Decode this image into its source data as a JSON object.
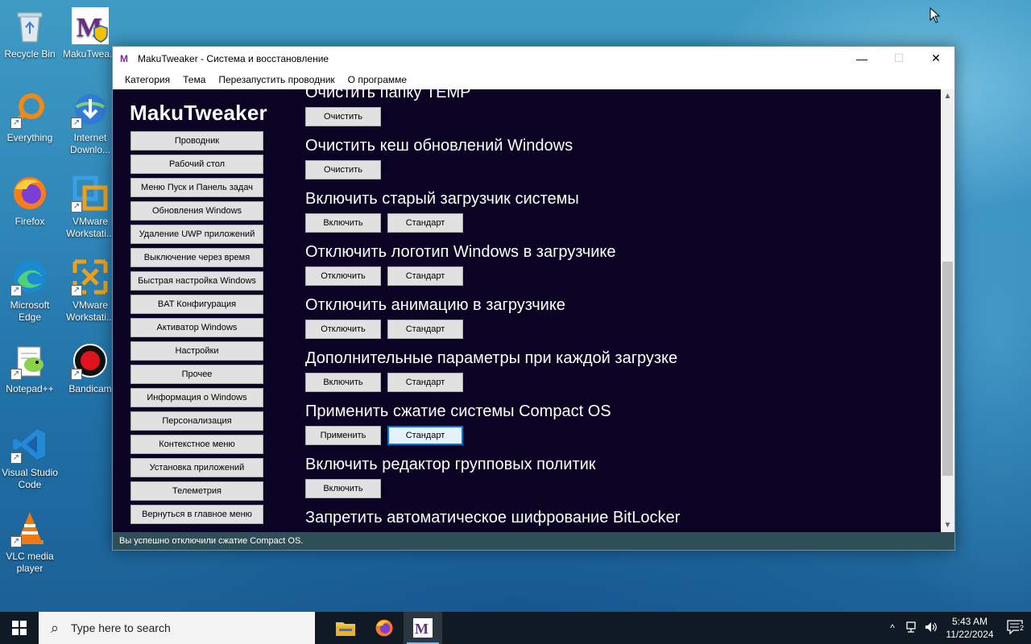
{
  "desktop": {
    "icons": [
      {
        "label": "Recycle Bin",
        "icon": "recycle-bin-icon"
      },
      {
        "label": "MakuTwea...",
        "icon": "makutweaker-icon"
      },
      {
        "label": "Everything",
        "icon": "everything-search-icon"
      },
      {
        "label": "Internet Downlo...",
        "icon": "internet-download-manager-icon"
      },
      {
        "label": "Firefox",
        "icon": "firefox-icon"
      },
      {
        "label": "VMware Workstati...",
        "icon": "vmware-icon"
      },
      {
        "label": "Microsoft Edge",
        "icon": "edge-icon"
      },
      {
        "label": "VMware Workstati...",
        "icon": "vmware-icon"
      },
      {
        "label": "Notepad++",
        "icon": "notepadpp-icon"
      },
      {
        "label": "Bandicam",
        "icon": "bandicam-icon"
      },
      {
        "label": "Visual Studio Code",
        "icon": "vscode-icon"
      },
      {
        "label": "VLC media player",
        "icon": "vlc-icon"
      }
    ]
  },
  "window": {
    "title": "MakuTweaker - Система и восстановление",
    "minimize": "—",
    "maximize": "☐",
    "close": "✕"
  },
  "menu": {
    "category": "Категория",
    "theme": "Тема",
    "restart_explorer": "Перезапустить проводник",
    "about": "О программе"
  },
  "sidebar": {
    "brand": "MakuTweaker",
    "items": [
      "Проводник",
      "Рабочий стол",
      "Меню Пуск и Панель задач",
      "Обновления Windows",
      "Удаление UWP приложений",
      "Выключение через время",
      "Быстрая настройка Windows",
      "BAT Конфигурация",
      "Активатор Windows",
      "Настройки",
      "Прочее",
      "Информация о Windows",
      "Персонализация",
      "Контекстное меню",
      "Установка приложений",
      "Телеметрия",
      "Вернуться в главное меню"
    ]
  },
  "settings": [
    {
      "title": "Очистить папку TEMP",
      "buttons": [
        "Очистить"
      ]
    },
    {
      "title": "Очистить кеш обновлений Windows",
      "buttons": [
        "Очистить"
      ]
    },
    {
      "title": "Включить старый загрузчик системы",
      "buttons": [
        "Включить",
        "Стандарт"
      ]
    },
    {
      "title": "Отключить логотип Windows в загрузчике",
      "buttons": [
        "Отключить",
        "Стандарт"
      ]
    },
    {
      "title": "Отключить анимацию в загрузчике",
      "buttons": [
        "Отключить",
        "Стандарт"
      ]
    },
    {
      "title": "Дополнительные параметры при каждой загрузке",
      "buttons": [
        "Включить",
        "Стандарт"
      ]
    },
    {
      "title": "Применить сжатие системы Compact OS",
      "buttons": [
        "Применить",
        "Стандарт"
      ]
    },
    {
      "title": "Включить редактор групповых политик",
      "buttons": [
        "Включить"
      ]
    },
    {
      "title": "Запретить автоматическое шифрование BitLocker",
      "buttons": []
    }
  ],
  "status": "Вы успешно отключили сжатие Compact OS.",
  "taskbar": {
    "search_placeholder": "Type here to search",
    "time": "5:43 AM",
    "date": "11/22/2024",
    "notification_count": "2"
  },
  "colors": {
    "content_bg": "#0a0324",
    "status_bg": "#2f4f58",
    "focus_border": "#0078d7"
  }
}
